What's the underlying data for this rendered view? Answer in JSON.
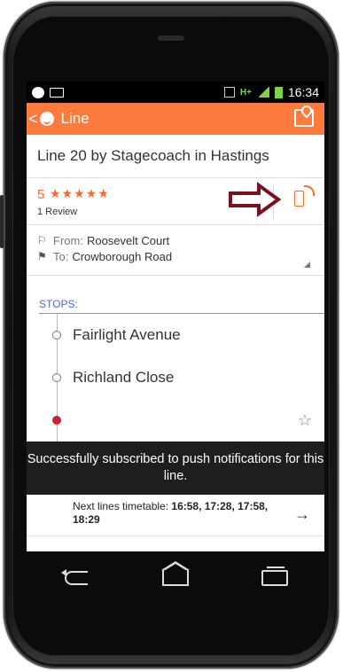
{
  "statusbar": {
    "time": "16:34",
    "network": "H+"
  },
  "actionbar": {
    "back": "<",
    "title": "Line"
  },
  "line": {
    "title": "Line 20  by Stagecoach in Hastings"
  },
  "rating": {
    "score": "5",
    "stars": "★★★★★",
    "value": 5,
    "reviews": "1 Review"
  },
  "route": {
    "from_label": "From:",
    "from_value": "Roosevelt Court",
    "to_label": "To:",
    "to_value": "Crowborough Road"
  },
  "stops": {
    "label": "STOPS:",
    "items": [
      {
        "name": "Fairlight Avenue"
      },
      {
        "name": "Richland Close"
      },
      {
        "name": ""
      }
    ]
  },
  "toast": {
    "message": "Successfully subscribed to push notifications for this line."
  },
  "timetable": {
    "label": "Next lines timetable: ",
    "times": "16:58, 17:28, 17:58, 18:29"
  },
  "colors": {
    "accent": "#ff7a3d",
    "annotation": "#7a1020",
    "link": "#4a6bd6"
  },
  "icons": [
    "back-icon",
    "app-logo-icon",
    "map-pin-icon",
    "phone-subscribe-icon",
    "flag-outline-icon",
    "flag-filled-icon",
    "star-outline-icon",
    "arrow-right-icon",
    "nav-back-icon",
    "nav-home-icon",
    "nav-recent-icon"
  ]
}
